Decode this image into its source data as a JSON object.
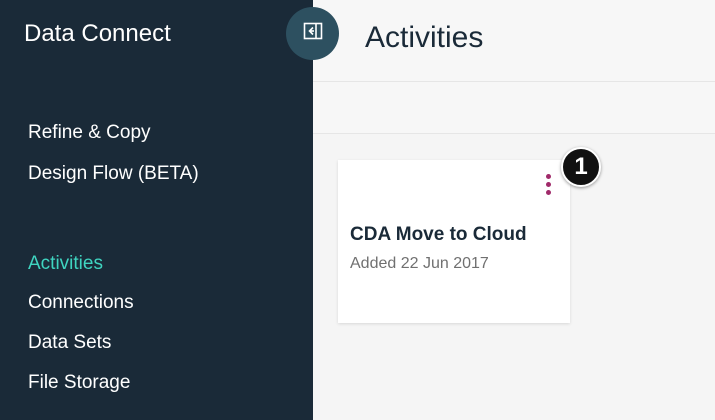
{
  "sidebar": {
    "app_title": "Data Connect",
    "collapse_icon": "collapse-sidebar-icon",
    "primary_items": [
      {
        "label": "Refine & Copy"
      },
      {
        "label": "Design Flow (BETA)"
      }
    ],
    "secondary_items": [
      {
        "label": "Activities",
        "active": true
      },
      {
        "label": "Connections"
      },
      {
        "label": "Data Sets"
      },
      {
        "label": "File Storage"
      }
    ]
  },
  "main": {
    "title": "Activities",
    "cards": [
      {
        "title": "CDA Move to Cloud",
        "date": "Added 22 Jun 2017",
        "menu_icon": "kebab-menu-icon"
      }
    ]
  },
  "annotation": {
    "callout_number": "1"
  },
  "colors": {
    "sidebar_bg": "#1a2a38",
    "active_nav": "#3fd4c0",
    "menu_dots": "#a02a6a",
    "callout_bg": "#111111"
  }
}
